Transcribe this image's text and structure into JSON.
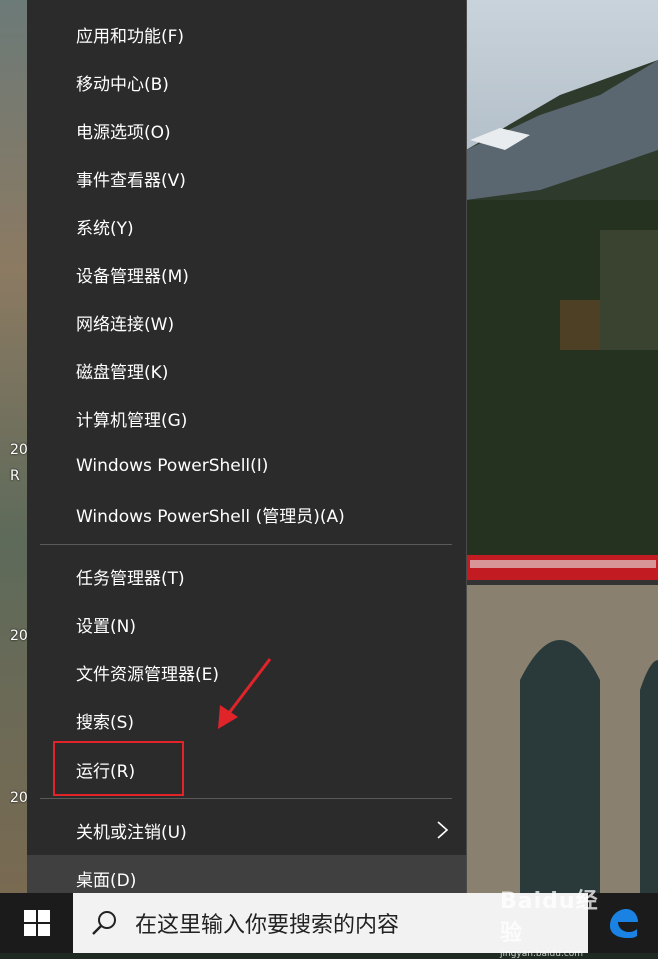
{
  "menu": {
    "items": [
      {
        "label": "应用和功能(F)"
      },
      {
        "label": "移动中心(B)"
      },
      {
        "label": "电源选项(O)"
      },
      {
        "label": "事件查看器(V)"
      },
      {
        "label": "系统(Y)"
      },
      {
        "label": "设备管理器(M)"
      },
      {
        "label": "网络连接(W)"
      },
      {
        "label": "磁盘管理(K)"
      },
      {
        "label": "计算机管理(G)"
      },
      {
        "label": "Windows PowerShell(I)"
      },
      {
        "label": "Windows PowerShell (管理员)(A)"
      },
      {
        "label": "任务管理器(T)"
      },
      {
        "label": "设置(N)"
      },
      {
        "label": "文件资源管理器(E)"
      },
      {
        "label": "搜索(S)"
      },
      {
        "label": "运行(R)"
      },
      {
        "label": "关机或注销(U)"
      },
      {
        "label": "桌面(D)"
      }
    ],
    "highlighted_item": "运行(R)",
    "hovered_item": "桌面(D)",
    "submenu_icon": "chevron-right-icon"
  },
  "taskbar": {
    "search_placeholder": "在这里输入你要搜索的内容",
    "start_icon": "windows-logo-icon",
    "search_icon": "search-icon",
    "pinned_icon": "edge-icon"
  },
  "desktop": {
    "icon_labels": [
      "20",
      "R",
      "20",
      "20"
    ]
  },
  "watermark": {
    "brand": "Baidu经验",
    "url": "jingyan.baidu.com"
  },
  "colors": {
    "menu_bg": "#2b2b2b",
    "menu_hover": "#404040",
    "annotation_red": "#e0242a",
    "taskbar_bg": "#1b1b1b",
    "edge_blue": "#1a82e2"
  }
}
